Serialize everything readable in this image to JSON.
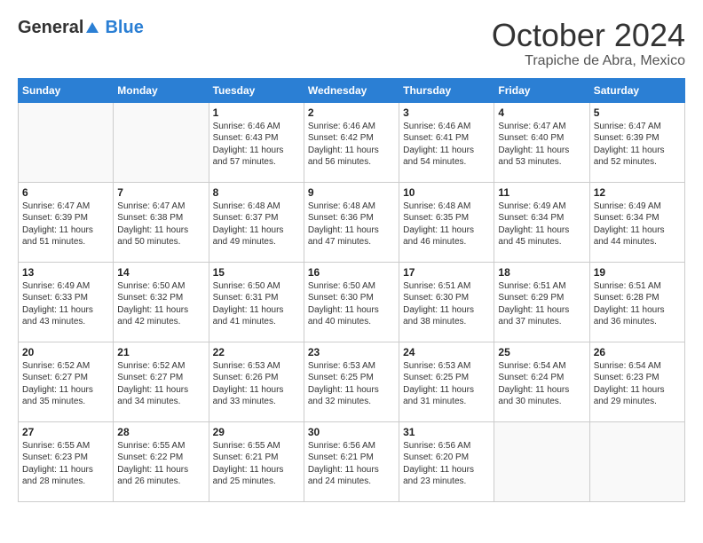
{
  "logo": {
    "general": "General",
    "blue": "Blue"
  },
  "title": "October 2024",
  "location": "Trapiche de Abra, Mexico",
  "days_of_week": [
    "Sunday",
    "Monday",
    "Tuesday",
    "Wednesday",
    "Thursday",
    "Friday",
    "Saturday"
  ],
  "weeks": [
    [
      {
        "day": "",
        "sunrise": "",
        "sunset": "",
        "daylight": ""
      },
      {
        "day": "",
        "sunrise": "",
        "sunset": "",
        "daylight": ""
      },
      {
        "day": "1",
        "sunrise": "Sunrise: 6:46 AM",
        "sunset": "Sunset: 6:43 PM",
        "daylight": "Daylight: 11 hours and 57 minutes."
      },
      {
        "day": "2",
        "sunrise": "Sunrise: 6:46 AM",
        "sunset": "Sunset: 6:42 PM",
        "daylight": "Daylight: 11 hours and 56 minutes."
      },
      {
        "day": "3",
        "sunrise": "Sunrise: 6:46 AM",
        "sunset": "Sunset: 6:41 PM",
        "daylight": "Daylight: 11 hours and 54 minutes."
      },
      {
        "day": "4",
        "sunrise": "Sunrise: 6:47 AM",
        "sunset": "Sunset: 6:40 PM",
        "daylight": "Daylight: 11 hours and 53 minutes."
      },
      {
        "day": "5",
        "sunrise": "Sunrise: 6:47 AM",
        "sunset": "Sunset: 6:39 PM",
        "daylight": "Daylight: 11 hours and 52 minutes."
      }
    ],
    [
      {
        "day": "6",
        "sunrise": "Sunrise: 6:47 AM",
        "sunset": "Sunset: 6:39 PM",
        "daylight": "Daylight: 11 hours and 51 minutes."
      },
      {
        "day": "7",
        "sunrise": "Sunrise: 6:47 AM",
        "sunset": "Sunset: 6:38 PM",
        "daylight": "Daylight: 11 hours and 50 minutes."
      },
      {
        "day": "8",
        "sunrise": "Sunrise: 6:48 AM",
        "sunset": "Sunset: 6:37 PM",
        "daylight": "Daylight: 11 hours and 49 minutes."
      },
      {
        "day": "9",
        "sunrise": "Sunrise: 6:48 AM",
        "sunset": "Sunset: 6:36 PM",
        "daylight": "Daylight: 11 hours and 47 minutes."
      },
      {
        "day": "10",
        "sunrise": "Sunrise: 6:48 AM",
        "sunset": "Sunset: 6:35 PM",
        "daylight": "Daylight: 11 hours and 46 minutes."
      },
      {
        "day": "11",
        "sunrise": "Sunrise: 6:49 AM",
        "sunset": "Sunset: 6:34 PM",
        "daylight": "Daylight: 11 hours and 45 minutes."
      },
      {
        "day": "12",
        "sunrise": "Sunrise: 6:49 AM",
        "sunset": "Sunset: 6:34 PM",
        "daylight": "Daylight: 11 hours and 44 minutes."
      }
    ],
    [
      {
        "day": "13",
        "sunrise": "Sunrise: 6:49 AM",
        "sunset": "Sunset: 6:33 PM",
        "daylight": "Daylight: 11 hours and 43 minutes."
      },
      {
        "day": "14",
        "sunrise": "Sunrise: 6:50 AM",
        "sunset": "Sunset: 6:32 PM",
        "daylight": "Daylight: 11 hours and 42 minutes."
      },
      {
        "day": "15",
        "sunrise": "Sunrise: 6:50 AM",
        "sunset": "Sunset: 6:31 PM",
        "daylight": "Daylight: 11 hours and 41 minutes."
      },
      {
        "day": "16",
        "sunrise": "Sunrise: 6:50 AM",
        "sunset": "Sunset: 6:30 PM",
        "daylight": "Daylight: 11 hours and 40 minutes."
      },
      {
        "day": "17",
        "sunrise": "Sunrise: 6:51 AM",
        "sunset": "Sunset: 6:30 PM",
        "daylight": "Daylight: 11 hours and 38 minutes."
      },
      {
        "day": "18",
        "sunrise": "Sunrise: 6:51 AM",
        "sunset": "Sunset: 6:29 PM",
        "daylight": "Daylight: 11 hours and 37 minutes."
      },
      {
        "day": "19",
        "sunrise": "Sunrise: 6:51 AM",
        "sunset": "Sunset: 6:28 PM",
        "daylight": "Daylight: 11 hours and 36 minutes."
      }
    ],
    [
      {
        "day": "20",
        "sunrise": "Sunrise: 6:52 AM",
        "sunset": "Sunset: 6:27 PM",
        "daylight": "Daylight: 11 hours and 35 minutes."
      },
      {
        "day": "21",
        "sunrise": "Sunrise: 6:52 AM",
        "sunset": "Sunset: 6:27 PM",
        "daylight": "Daylight: 11 hours and 34 minutes."
      },
      {
        "day": "22",
        "sunrise": "Sunrise: 6:53 AM",
        "sunset": "Sunset: 6:26 PM",
        "daylight": "Daylight: 11 hours and 33 minutes."
      },
      {
        "day": "23",
        "sunrise": "Sunrise: 6:53 AM",
        "sunset": "Sunset: 6:25 PM",
        "daylight": "Daylight: 11 hours and 32 minutes."
      },
      {
        "day": "24",
        "sunrise": "Sunrise: 6:53 AM",
        "sunset": "Sunset: 6:25 PM",
        "daylight": "Daylight: 11 hours and 31 minutes."
      },
      {
        "day": "25",
        "sunrise": "Sunrise: 6:54 AM",
        "sunset": "Sunset: 6:24 PM",
        "daylight": "Daylight: 11 hours and 30 minutes."
      },
      {
        "day": "26",
        "sunrise": "Sunrise: 6:54 AM",
        "sunset": "Sunset: 6:23 PM",
        "daylight": "Daylight: 11 hours and 29 minutes."
      }
    ],
    [
      {
        "day": "27",
        "sunrise": "Sunrise: 6:55 AM",
        "sunset": "Sunset: 6:23 PM",
        "daylight": "Daylight: 11 hours and 28 minutes."
      },
      {
        "day": "28",
        "sunrise": "Sunrise: 6:55 AM",
        "sunset": "Sunset: 6:22 PM",
        "daylight": "Daylight: 11 hours and 26 minutes."
      },
      {
        "day": "29",
        "sunrise": "Sunrise: 6:55 AM",
        "sunset": "Sunset: 6:21 PM",
        "daylight": "Daylight: 11 hours and 25 minutes."
      },
      {
        "day": "30",
        "sunrise": "Sunrise: 6:56 AM",
        "sunset": "Sunset: 6:21 PM",
        "daylight": "Daylight: 11 hours and 24 minutes."
      },
      {
        "day": "31",
        "sunrise": "Sunrise: 6:56 AM",
        "sunset": "Sunset: 6:20 PM",
        "daylight": "Daylight: 11 hours and 23 minutes."
      },
      {
        "day": "",
        "sunrise": "",
        "sunset": "",
        "daylight": ""
      },
      {
        "day": "",
        "sunrise": "",
        "sunset": "",
        "daylight": ""
      }
    ]
  ]
}
